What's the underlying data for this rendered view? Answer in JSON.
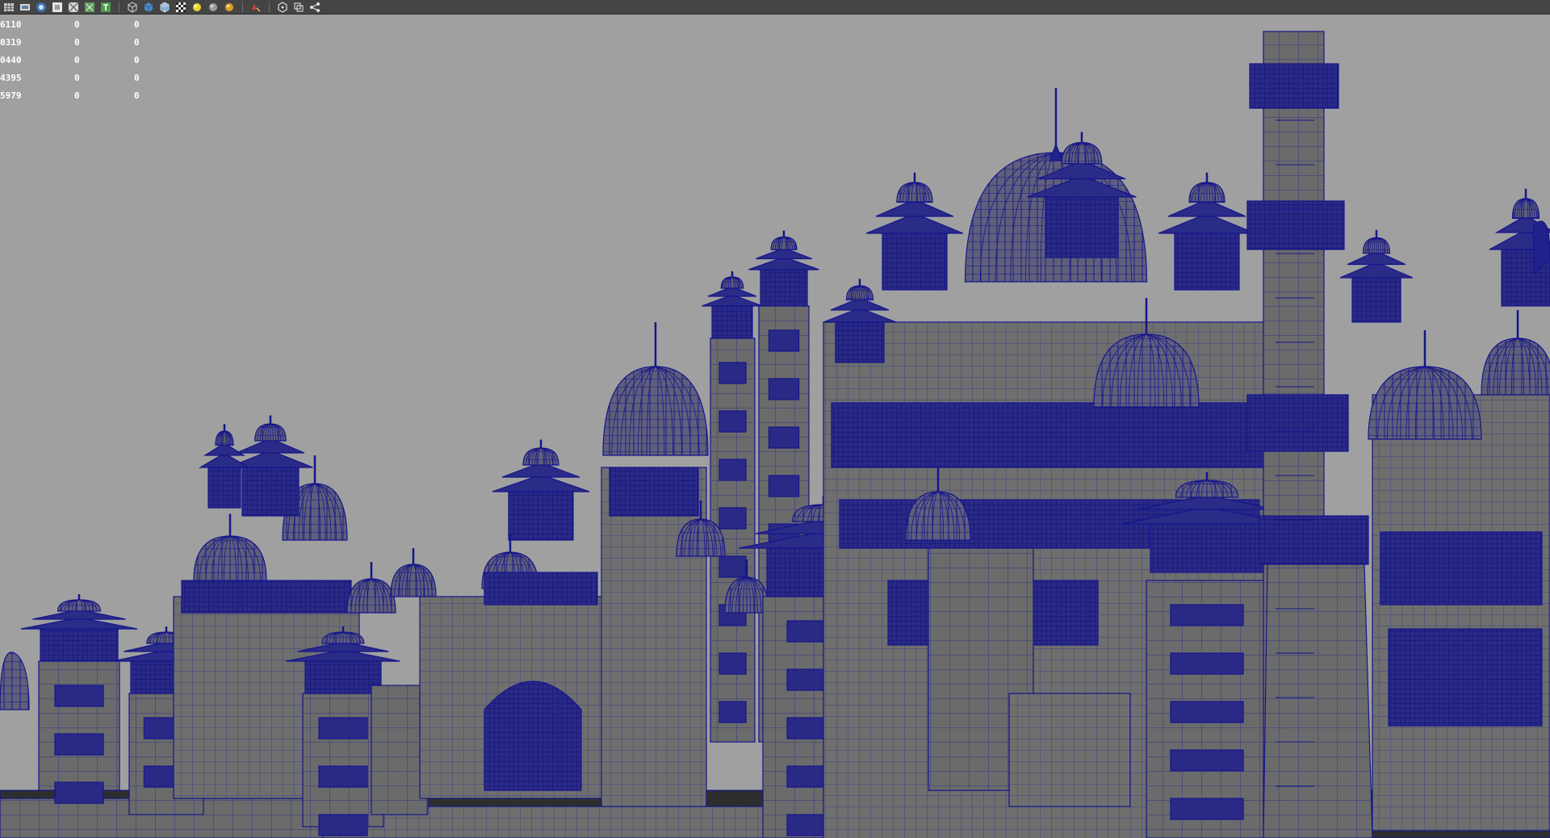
{
  "toolbar": {
    "groups": [
      [
        "grid-icon",
        "film-gate-icon",
        "resolution-gate-icon",
        "gate-mask-icon",
        "field-chart-icon",
        "safe-action-icon",
        "safe-title-icon"
      ],
      [
        "wireframe-cube-icon",
        "smooth-shade-icon",
        "wireframe-on-shaded-icon",
        "textured-icon",
        "default-light-icon",
        "all-lights-icon",
        "shadows-icon"
      ],
      [
        "isolate-select-icon"
      ],
      [
        "xray-icon",
        "xray-joints-icon",
        "share-icon"
      ]
    ]
  },
  "hud": {
    "rows": [
      [
        "6110",
        "0",
        "0"
      ],
      [
        "0319",
        "0",
        "0"
      ],
      [
        "0440",
        "0",
        "0"
      ],
      [
        "4395",
        "0",
        "0"
      ],
      [
        "5979",
        "0",
        "0"
      ]
    ]
  },
  "colors": {
    "background": "#a0a0a0",
    "mesh_fill": "#707070",
    "wireframe": "#17178f",
    "toolbar": "#444444"
  }
}
